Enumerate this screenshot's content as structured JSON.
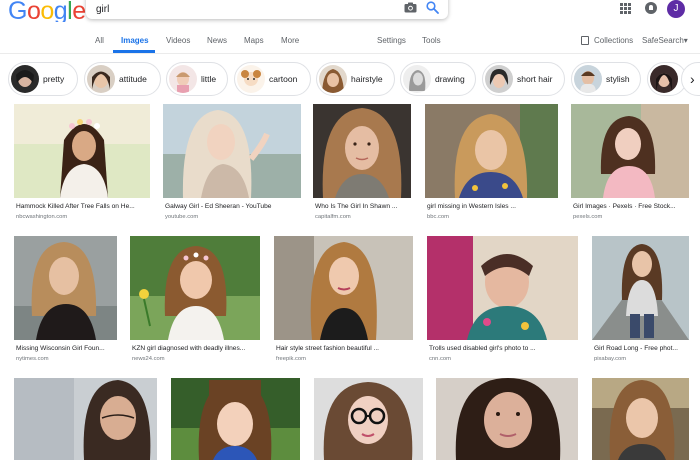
{
  "header": {
    "logo_letters": [
      "G",
      "o",
      "o",
      "g",
      "l",
      "e"
    ],
    "logo_colors": [
      "#4285f4",
      "#ea4335",
      "#fbbc05",
      "#4285f4",
      "#34a853",
      "#ea4335"
    ],
    "search_query": "girl",
    "avatar_letter": "J",
    "avatar_color": "#5e2ca5",
    "icons": [
      "camera-icon",
      "search-icon",
      "apps-grid-icon",
      "notifications-icon"
    ]
  },
  "tabs": {
    "all": "All",
    "images": "Images",
    "videos": "Videos",
    "news": "News",
    "maps": "Maps",
    "more": "More",
    "settings": "Settings",
    "tools": "Tools",
    "collections": "Collections",
    "safesearch": "SafeSearch▾",
    "active_color": "#1a73e8"
  },
  "chips": [
    "pretty",
    "attitude",
    "little",
    "cartoon",
    "hairstyle",
    "drawing",
    "short hair",
    "stylish"
  ],
  "results": [
    {
      "caption": "Hammock Killed After Tree Falls on He...",
      "source": "nbcwashington.com"
    },
    {
      "caption": "Galway Girl - Ed Sheeran - YouTube",
      "source": "youtube.com"
    },
    {
      "caption": "Who Is The Girl In Shawn ...",
      "source": "capitalfm.com"
    },
    {
      "caption": "girl missing in Western Isles ...",
      "source": "bbc.com"
    },
    {
      "caption": "Girl Images · Pexels · Free Stock...",
      "source": "pexels.com"
    },
    {
      "caption": "Missing Wisconsin Girl Foun...",
      "source": "nytimes.com"
    },
    {
      "caption": "KZN girl diagnosed with deadly illnes...",
      "source": "news24.com"
    },
    {
      "caption": "Hair style street fashion beautiful ...",
      "source": "freepik.com"
    },
    {
      "caption": "Trolls used disabled girl's photo to ...",
      "source": "cnn.com"
    },
    {
      "caption": "Girl Road Long - Free phot...",
      "source": "pixabay.com"
    }
  ]
}
